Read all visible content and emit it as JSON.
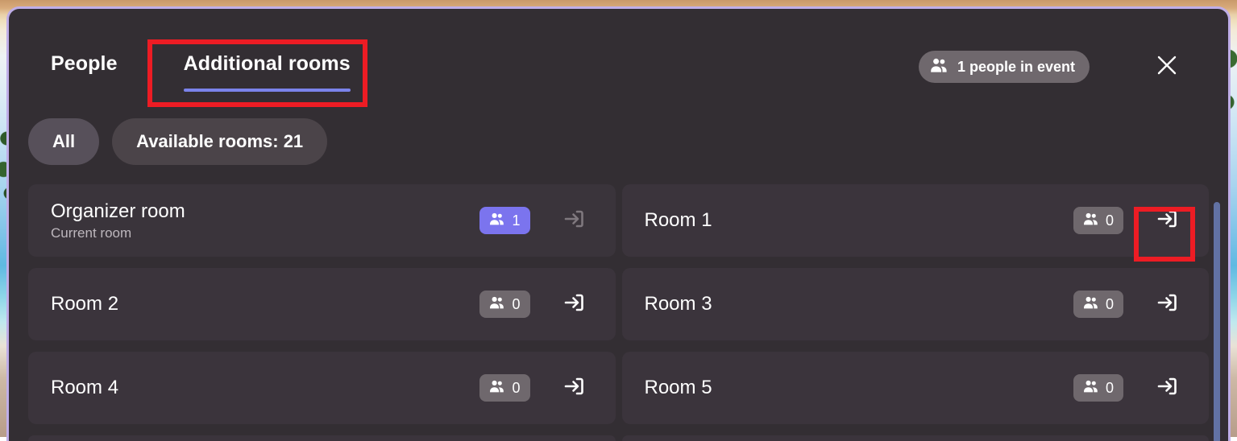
{
  "header": {
    "tabs": [
      {
        "label": "People",
        "selected": false
      },
      {
        "label": "Additional rooms",
        "selected": true
      }
    ],
    "people_badge": {
      "icon": "people-icon",
      "label": "1 people in event"
    },
    "close": {
      "icon": "close-icon",
      "label": "Close"
    }
  },
  "filters": [
    {
      "label": "All",
      "selected": true
    },
    {
      "label": "Available rooms: 21",
      "selected": false
    }
  ],
  "rooms": [
    {
      "name": "Organizer room",
      "subtitle": "Current room",
      "count": "1",
      "badge_style": "accent",
      "enter_enabled": false
    },
    {
      "name": "Room 1",
      "subtitle": "",
      "count": "0",
      "badge_style": "default",
      "enter_enabled": true
    },
    {
      "name": "Room 2",
      "subtitle": "",
      "count": "0",
      "badge_style": "default",
      "enter_enabled": true
    },
    {
      "name": "Room 3",
      "subtitle": "",
      "count": "0",
      "badge_style": "default",
      "enter_enabled": true
    },
    {
      "name": "Room 4",
      "subtitle": "",
      "count": "0",
      "badge_style": "default",
      "enter_enabled": true
    },
    {
      "name": "Room 5",
      "subtitle": "",
      "count": "0",
      "badge_style": "default",
      "enter_enabled": true
    }
  ],
  "icons": {
    "enter_room": "enter-room-icon",
    "people": "people-icon",
    "close": "close-icon"
  },
  "colors": {
    "accent": "#7b83eb",
    "badge_accent": "#7b74ee",
    "dialog_bg": "#332e33",
    "card_bg": "#3b343c",
    "chip_bg": "#4b4449",
    "chip_selected_bg": "#57505a",
    "annotation": "#ed1c24",
    "dialog_border": "#bfaee8",
    "scrollbar": "#6272a4"
  },
  "annotations": [
    {
      "target": "tab-additional-rooms",
      "color": "#ed1c24"
    },
    {
      "target": "room-1-enter-button",
      "color": "#ed1c24"
    }
  ]
}
